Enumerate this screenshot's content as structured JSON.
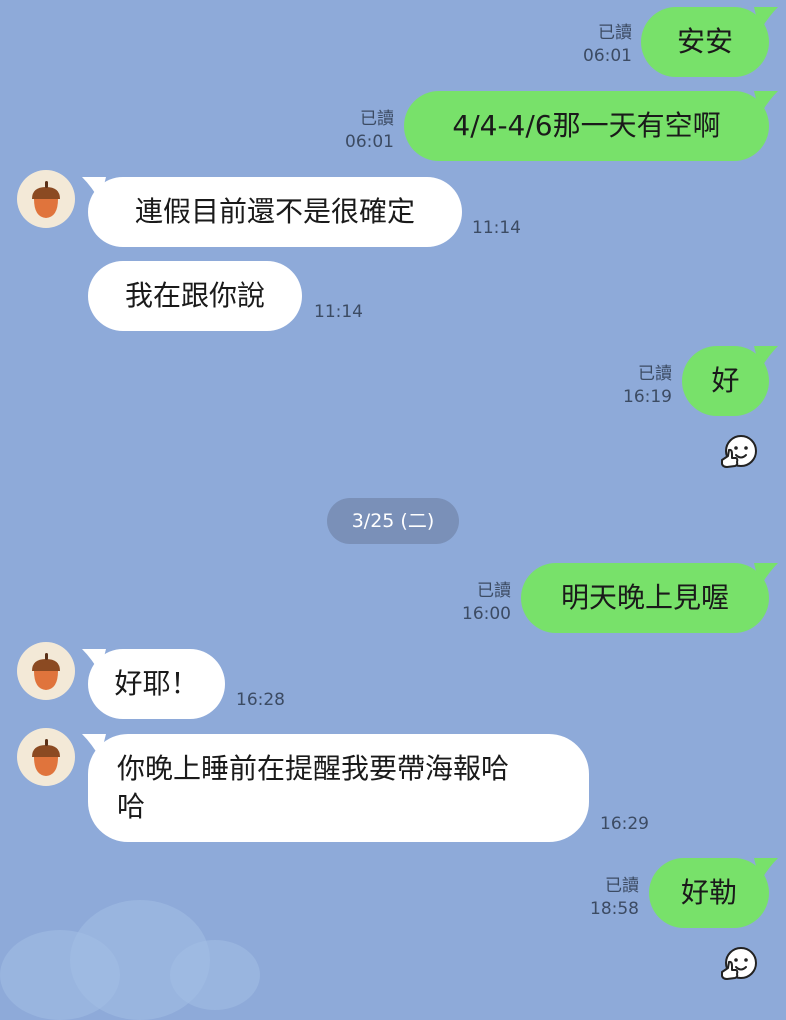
{
  "colors": {
    "background": "#8eaad9",
    "outgoing_bubble": "#78e16a",
    "incoming_bubble": "#ffffff",
    "date_pill": "#7a90b8"
  },
  "contact": {
    "avatar_icon": "acorn-icon"
  },
  "messages": [
    {
      "direction": "out",
      "text": "安安",
      "read": "已讀",
      "time": "06:01"
    },
    {
      "direction": "out",
      "text": "4/4-4/6那一天有空啊",
      "read": "已讀",
      "time": "06:01"
    },
    {
      "direction": "in",
      "text": "連假目前還不是很確定",
      "time": "11:14"
    },
    {
      "direction": "in",
      "text": "我在跟你說",
      "time": "11:14"
    },
    {
      "direction": "out",
      "text": "好",
      "read": "已讀",
      "time": "16:19",
      "reaction": "thumbs-up-face-icon"
    },
    {
      "direction": "out",
      "text": "明天晚上見喔",
      "read": "已讀",
      "time": "16:00"
    },
    {
      "direction": "in",
      "text": "好耶！",
      "time": "16:28"
    },
    {
      "direction": "in",
      "lines": [
        "你晚上睡前在提醒我要帶海報哈",
        "哈"
      ],
      "time": "16:29"
    },
    {
      "direction": "out",
      "text": "好勒",
      "read": "已讀",
      "time": "18:58",
      "reaction": "thumbs-up-face-icon"
    }
  ],
  "date_separator": "3/25 (二)"
}
